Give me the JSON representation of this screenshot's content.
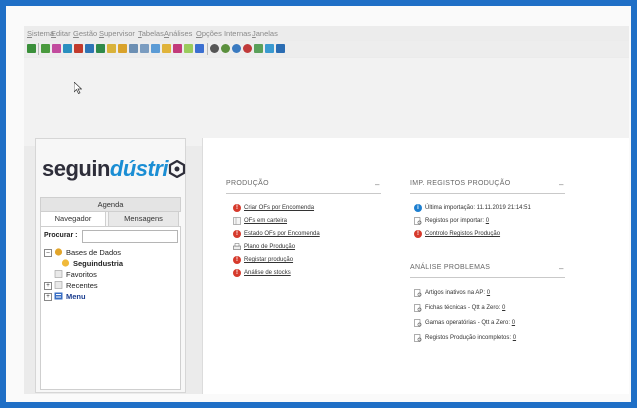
{
  "menubar": {
    "items": [
      "Sistema",
      "Editar",
      "Gestão",
      "Supervisor",
      "Tabelas",
      "Análises",
      "Opções Internas",
      "Janelas"
    ]
  },
  "logo": {
    "text_a": "seguin",
    "text_b": "dústri",
    "text_c": "○"
  },
  "left_panel": {
    "agenda_label": "Agenda",
    "tabs": [
      "Navegador",
      "Mensagens"
    ],
    "search_label": "Procurar :",
    "search_value": "",
    "tree": {
      "bases_label": "Bases de Dados",
      "db_item": "Seguindustria",
      "favoritos": "Favoritos",
      "recentes": "Recentes",
      "menu": "Menu"
    }
  },
  "producao": {
    "title": "PRODUÇÃO",
    "collapse": "–",
    "items": [
      "Criar OFs por Encomenda",
      "OFs em carteira",
      "Estado OFs por Encomenda",
      "Plano de Produção",
      "Registar produção",
      "Análise de stocks"
    ]
  },
  "imp_registos": {
    "title": "IMP. REGISTOS PRODUÇÃO",
    "collapse": "–",
    "last_import": "Última importação: 11.11.2019 21:14:51",
    "to_import": "Registos por importar:",
    "to_import_count": "0",
    "control": "Controlo Registos Produção"
  },
  "analise": {
    "title": "ANÁLISE PROBLEMAS",
    "collapse": "–",
    "items": [
      {
        "label": "Artigos inativos na AP:",
        "count": "0"
      },
      {
        "label": "Fichas técnicas - Qtt a Zero:",
        "count": "0"
      },
      {
        "label": "Gamas operatórias - Qtt a Zero:",
        "count": "0"
      },
      {
        "label": "Registos Produção incompletos:",
        "count": "0"
      }
    ]
  },
  "colors": {
    "border": "#1f6fc6",
    "accent": "#1b8ed4",
    "alert": "#d63a2c",
    "info": "#1d7fd0"
  }
}
